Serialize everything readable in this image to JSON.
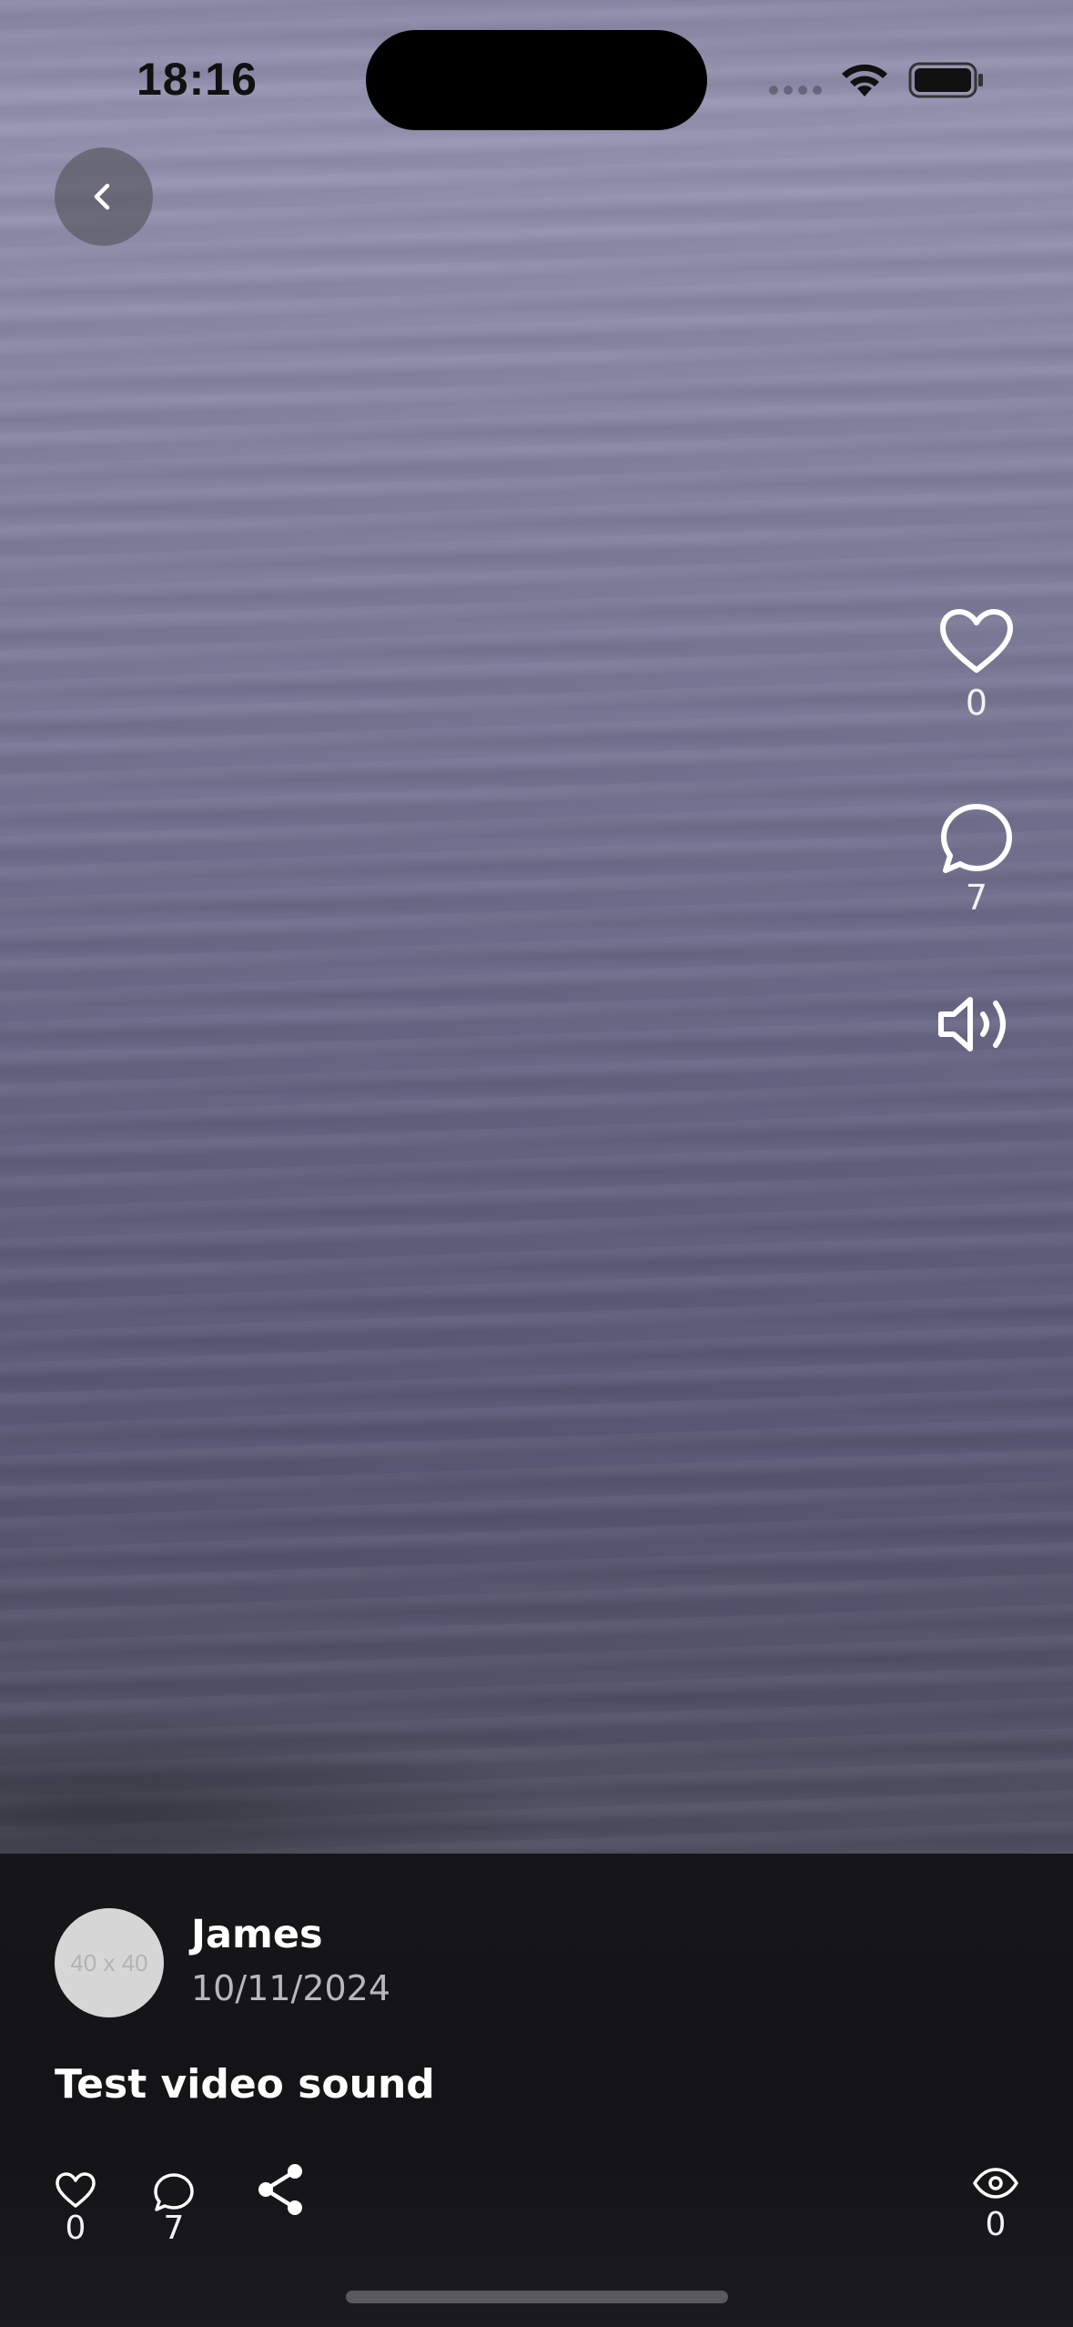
{
  "status_bar": {
    "time": "18:16",
    "signal_icon": "signal-dots-icon",
    "wifi_icon": "wifi-icon",
    "battery_icon": "battery-icon"
  },
  "header": {
    "back_icon": "chevron-left-icon"
  },
  "video": {
    "subject": "water-surface-video"
  },
  "right_rail": {
    "like_icon": "heart-icon",
    "like_count": "0",
    "comment_icon": "comment-bubble-icon",
    "comment_count": "7",
    "sound_icon": "speaker-on-icon"
  },
  "post": {
    "avatar_placeholder": "40 x 40",
    "author": "James",
    "date": "10/11/2024",
    "caption": "Test video sound"
  },
  "actions": {
    "like_icon": "heart-icon",
    "like_count": "0",
    "comment_icon": "comment-bubble-icon",
    "comment_count": "7",
    "share_icon": "share-icon",
    "views_icon": "eye-icon",
    "views_count": "0"
  },
  "colors": {
    "panel_background": "#161618",
    "text_primary": "#ffffff",
    "text_secondary": "#b8b8bc",
    "back_button_bg": "#5a5a64"
  }
}
